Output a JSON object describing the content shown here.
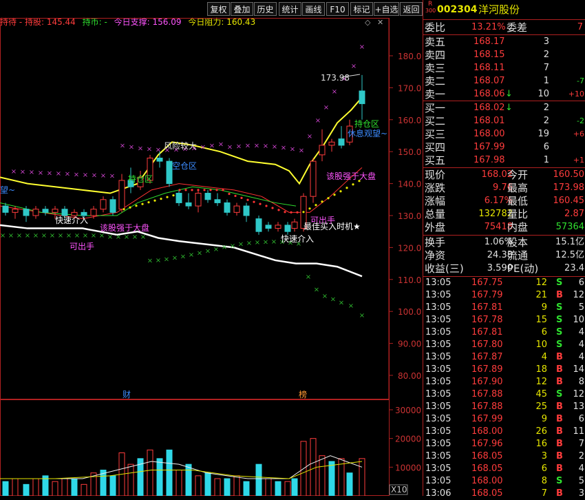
{
  "toolbar": {
    "buttons": [
      "复权",
      "叠加",
      "历史",
      "统计",
      "画线",
      "F10",
      "标记",
      "+自选",
      "返回"
    ]
  },
  "indicator_row": {
    "items": [
      {
        "text": "持待 - 持股: 145.44",
        "color": "#ff3c3c"
      },
      {
        "text": "持币: -",
        "color": "#2fe02f"
      },
      {
        "text": "今日支撑: 156.09",
        "color": "#ff55ff"
      },
      {
        "text": "今日阻力: 160.43",
        "color": "#e6e600"
      }
    ]
  },
  "price_axis": [
    "180.0",
    "170.0",
    "160.0",
    "150.0",
    "140.0",
    "130.0",
    "120.0",
    "110.0",
    "100.0",
    "90.00",
    "80.00"
  ],
  "volume_axis": [
    "30000",
    "20000",
    "10000"
  ],
  "volume_unit": "X10",
  "chart_annotations": {
    "high_label": "173.98",
    "risk": "风险较大",
    "empty_zone": "空仓区",
    "hold_zone_1": "持仓区",
    "hold_zone_2": "持仓区",
    "fast_enter_1": "快速介入",
    "fast_enter_2": "快速介入",
    "beat_market_1": "该股强于大盘",
    "beat_market_2": "该股强于大盘",
    "can_sell_1": "可出手",
    "can_sell_2": "可出手",
    "best_buy": "最佳买入时机★",
    "wait_watch": "休息观望~",
    "left_cut_1": "望~",
    "marker_cai": "财",
    "marker_bang": "榜"
  },
  "stock": {
    "badge_top": "R",
    "badge_bottom": "300",
    "code": "002304",
    "name": "洋河股份"
  },
  "order_book": {
    "weibi_label": "委比",
    "weibi_value": "13.21%",
    "weicha_label": "委差",
    "weicha_value": "7",
    "asks": [
      {
        "label": "卖五",
        "price": "168.17",
        "vol": "3",
        "chg": ""
      },
      {
        "label": "卖四",
        "price": "168.15",
        "vol": "2",
        "chg": ""
      },
      {
        "label": "卖三",
        "price": "168.11",
        "vol": "7",
        "chg": ""
      },
      {
        "label": "卖二",
        "price": "168.07",
        "vol": "1",
        "chg": "-7"
      },
      {
        "label": "卖一",
        "price": "168.06",
        "vol": "10",
        "chg": "+10",
        "arrow": "↓"
      }
    ],
    "bids": [
      {
        "label": "买一",
        "price": "168.02",
        "vol": "2",
        "chg": "",
        "arrow": "↓"
      },
      {
        "label": "买二",
        "price": "168.01",
        "vol": "2",
        "chg": "-2"
      },
      {
        "label": "买三",
        "price": "168.00",
        "vol": "19",
        "chg": "+6"
      },
      {
        "label": "买四",
        "price": "167.99",
        "vol": "6",
        "chg": ""
      },
      {
        "label": "买五",
        "price": "167.98",
        "vol": "1",
        "chg": "+1"
      }
    ]
  },
  "quote": {
    "rows": [
      {
        "l1": "现价",
        "v1": "168.02",
        "l2": "今开",
        "v2": "160.50",
        "c1": "r",
        "c2": "r"
      },
      {
        "l1": "涨跌",
        "v1": "9.76",
        "l2": "最高",
        "v2": "173.98",
        "c1": "r",
        "c2": "r"
      },
      {
        "l1": "涨幅",
        "v1": "6.17%",
        "l2": "最低",
        "v2": "160.45",
        "c1": "r",
        "c2": "r"
      },
      {
        "l1": "总量",
        "v1": "132782",
        "l2": "量比",
        "v2": "2.87",
        "c1": "y",
        "c2": "r"
      },
      {
        "l1": "外盘",
        "v1": "75418",
        "l2": "内盘",
        "v2": "57364",
        "c1": "r",
        "c2": "g"
      }
    ],
    "rows2": [
      {
        "l1": "换手",
        "v1": "1.06%",
        "l2": "股本",
        "v2": "15.1亿"
      },
      {
        "l1": "净资",
        "v1": "24.38",
        "l2": "流通",
        "v2": "12.5亿"
      },
      {
        "l1": "收益(三)",
        "v1": "3.590",
        "l2": "PE(动)",
        "v2": "23.4"
      }
    ]
  },
  "trades": [
    {
      "time": "13:05",
      "price": "167.75",
      "vol": "12",
      "side": "S",
      "n": "6"
    },
    {
      "time": "13:05",
      "price": "167.79",
      "vol": "21",
      "side": "B",
      "n": "12"
    },
    {
      "time": "13:05",
      "price": "167.81",
      "vol": "9",
      "side": "S",
      "n": "5"
    },
    {
      "time": "13:05",
      "price": "167.78",
      "vol": "15",
      "side": "S",
      "n": "10"
    },
    {
      "time": "13:05",
      "price": "167.81",
      "vol": "6",
      "side": "S",
      "n": "4"
    },
    {
      "time": "13:05",
      "price": "167.80",
      "vol": "10",
      "side": "S",
      "n": "4"
    },
    {
      "time": "13:05",
      "price": "167.87",
      "vol": "4",
      "side": "B",
      "n": "4"
    },
    {
      "time": "13:05",
      "price": "167.89",
      "vol": "18",
      "side": "B",
      "n": "14"
    },
    {
      "time": "13:05",
      "price": "167.90",
      "vol": "12",
      "side": "B",
      "n": "8"
    },
    {
      "time": "13:05",
      "price": "167.88",
      "vol": "45",
      "side": "S",
      "n": "12"
    },
    {
      "time": "13:05",
      "price": "167.88",
      "vol": "25",
      "side": "B",
      "n": "13"
    },
    {
      "time": "13:05",
      "price": "167.99",
      "vol": "9",
      "side": "B",
      "n": "6"
    },
    {
      "time": "13:05",
      "price": "168.00",
      "vol": "26",
      "side": "B",
      "n": "11"
    },
    {
      "time": "13:05",
      "price": "167.96",
      "vol": "16",
      "side": "B",
      "n": "7"
    },
    {
      "time": "13:05",
      "price": "168.05",
      "vol": "3",
      "side": "B",
      "n": "2"
    },
    {
      "time": "13:05",
      "price": "168.05",
      "vol": "6",
      "side": "B",
      "n": "4"
    },
    {
      "time": "13:05",
      "price": "168.00",
      "vol": "8",
      "side": "S",
      "n": "5"
    },
    {
      "time": "13:06",
      "price": "168.05",
      "vol": "7",
      "side": "B",
      "n": "3"
    }
  ],
  "colors": {
    "up": "#ff3c3c",
    "down": "#2fe02f",
    "accent": "#e6e600",
    "border": "#b02020"
  }
}
